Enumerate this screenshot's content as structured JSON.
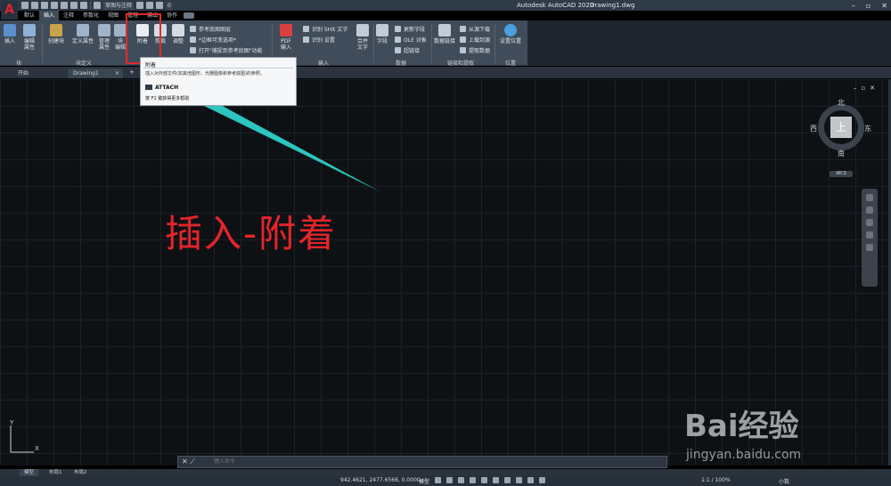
{
  "window": {
    "app_title": "Autodesk AutoCAD 2020",
    "file_name": "Drawing1.dwg",
    "workspace": "草图与注释",
    "layer_value": "0"
  },
  "ribbon_tabs": [
    "默认",
    "插入",
    "注释",
    "参数化",
    "视图",
    "管理",
    "输出",
    "协作"
  ],
  "ribbon": {
    "insert_label": "插入",
    "edit_attr_label": "编辑\n属性",
    "create_block_label": "创建块",
    "define_attr_label": "定义属性",
    "manage_attr_label": "管理\n属性",
    "block_editor_label": "块\n编辑",
    "attach_label": "附着",
    "clip_label": "剪裁",
    "adjust_label": "调整",
    "ref_layer_label": "参考底图图层",
    "frames_label": "*边框可变选项*",
    "snap_ref_label": "打开\"捕捉到参考底图\"功能",
    "pdf_import_label": "PDF\n输入",
    "recog_shx_label": "识别 SHX 文字",
    "recog_settings_label": "识别 设置",
    "combine_text_label": "合并\n文字",
    "field_label": "字段",
    "update_field_label": "更新字段",
    "ole_label": "OLE 对象",
    "hyperlink_label": "超链接",
    "data_link_label": "数据链接",
    "download_source_label": "从源下载",
    "upload_source_label": "上载到源",
    "extract_data_label": "提取数据",
    "set_location_label": "设置位置",
    "panels": {
      "block": "块",
      "block_def": "块定义",
      "reference": "参照",
      "import": "输入",
      "data": "数据",
      "linking": "链接和提取",
      "location": "位置"
    }
  },
  "file_tabs": {
    "start": "开始",
    "drawing": "Drawing1",
    "close": "×",
    "plus": "+"
  },
  "tooltip": {
    "title": "附着",
    "description": "插入对外部文件(如其他图形、光栅图像和参考底图)的参照。",
    "command": "ATTACH",
    "help": "按 F1 键获得更多帮助"
  },
  "annotation": "插入-附着",
  "viewcube": {
    "top": "上",
    "north": "北",
    "south": "南",
    "east": "东",
    "west": "西",
    "wcs": "WCS"
  },
  "ucs": {
    "x": "X",
    "y": "Y"
  },
  "command_line": {
    "placeholder": "键入命令"
  },
  "layout_tabs": [
    "模型",
    "布局1",
    "布局2"
  ],
  "status": {
    "coords": "942.4621, 2477.6566, 0.0000",
    "model": "模型",
    "scale": "1:1 / 100%",
    "units": "小数"
  },
  "watermark": {
    "brand": "Bai经验",
    "url": "jingyan.baidu.com"
  },
  "colors": {
    "highlight": "#e02a2a",
    "arrow": "#2bc6c0",
    "annotation": "#e4252a"
  }
}
